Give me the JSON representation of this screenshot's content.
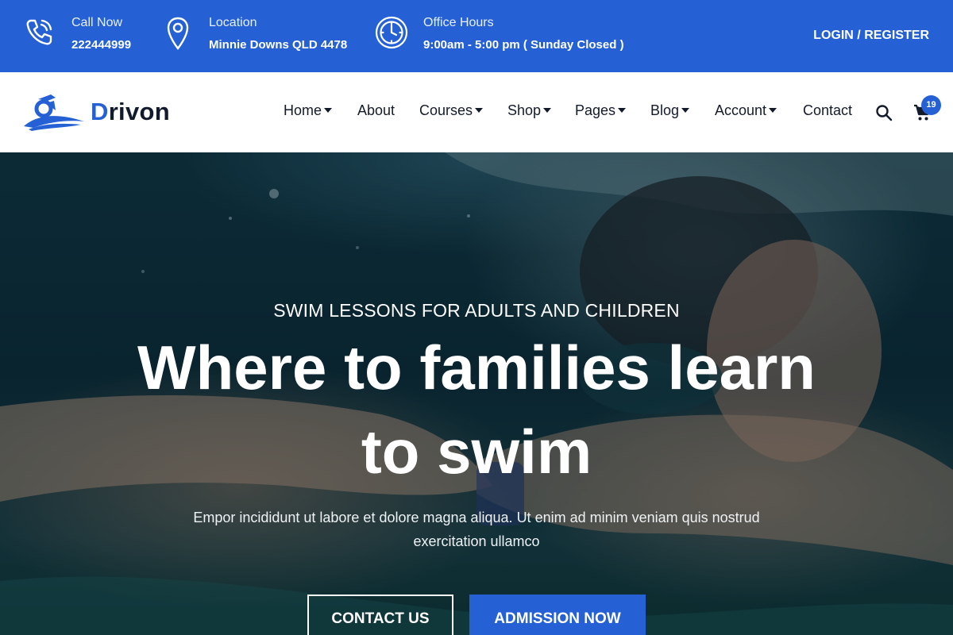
{
  "topbar": {
    "call": {
      "label": "Call Now",
      "value": "222444999",
      "icon": "phone-icon"
    },
    "location": {
      "label": "Location",
      "value": "Minnie Downs QLD 4478",
      "icon": "map-pin-icon"
    },
    "hours": {
      "label": "Office Hours",
      "value": "9:00am - 5:00 pm ( Sunday Closed )",
      "icon": "clock-icon"
    },
    "login_label": "LOGIN",
    "separator": "/",
    "register_label": "REGISTER"
  },
  "brand": {
    "first_letter": "D",
    "rest": "rivon",
    "accent_color": "#2561d4"
  },
  "nav": {
    "items": [
      {
        "label": "Home",
        "has_dropdown": true
      },
      {
        "label": "About",
        "has_dropdown": false
      },
      {
        "label": "Courses",
        "has_dropdown": true
      },
      {
        "label": "Shop",
        "has_dropdown": true
      },
      {
        "label": "Pages",
        "has_dropdown": true
      },
      {
        "label": "Blog",
        "has_dropdown": true
      },
      {
        "label": "Account",
        "has_dropdown": true
      },
      {
        "label": "Contact",
        "has_dropdown": false
      }
    ],
    "cart_count": "19"
  },
  "hero": {
    "subtitle": "SWIM LESSONS FOR ADULTS AND CHILDREN",
    "title": "Where to families learn to swim",
    "description": "Empor incididunt ut labore et dolore magna aliqua. Ut enim ad minim veniam quis nostrud exercitation ullamco",
    "primary_button": "CONTACT US",
    "secondary_button": "ADMISSION NOW"
  },
  "colors": {
    "primary": "#2561d4",
    "dark_text": "#131b2b",
    "white": "#ffffff"
  }
}
